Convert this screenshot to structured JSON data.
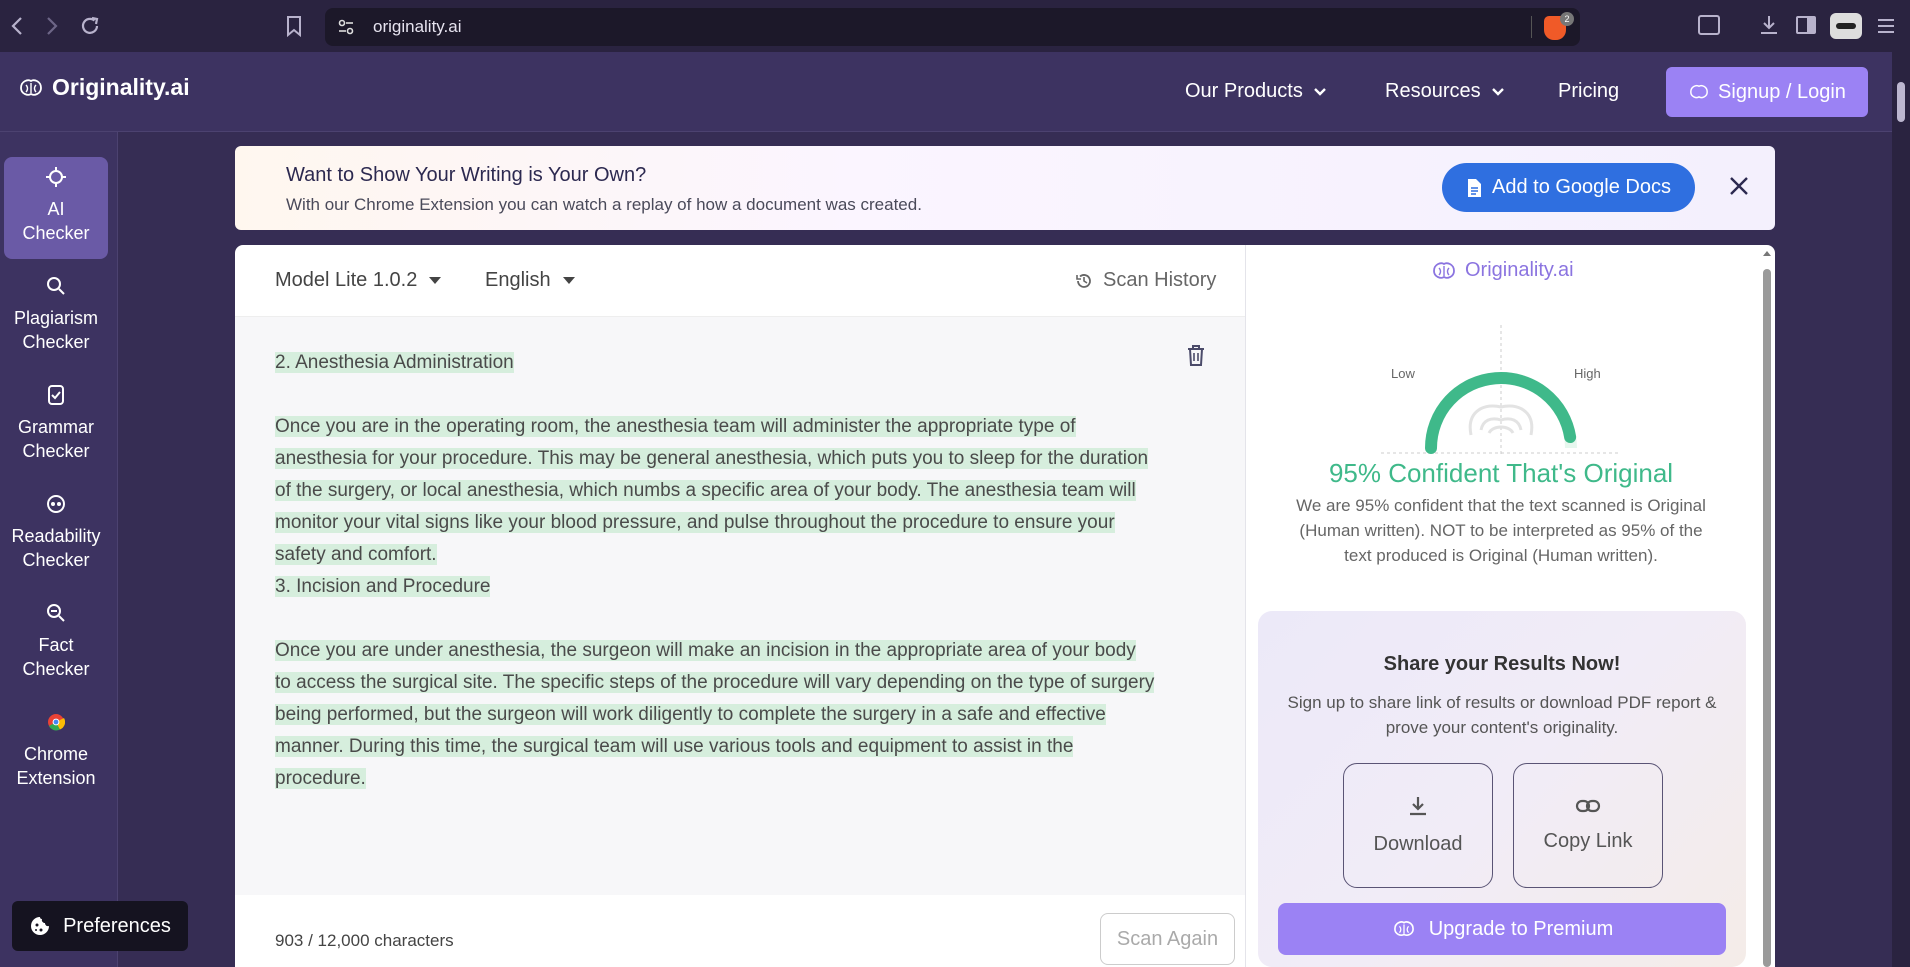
{
  "browser": {
    "url": "originality.ai",
    "brave_badge": "2"
  },
  "header": {
    "logo": "Originality.ai",
    "nav": [
      "Our Products",
      "Resources",
      "Pricing"
    ],
    "signup": "Signup / Login"
  },
  "sidebar": {
    "items": [
      {
        "line1": "AI",
        "line2": "Checker",
        "icon": "ai-chip-icon"
      },
      {
        "line1": "Plagiarism",
        "line2": "Checker",
        "icon": "magnify-icon"
      },
      {
        "line1": "Grammar",
        "line2": "Checker",
        "icon": "check-doc-icon"
      },
      {
        "line1": "Readability",
        "line2": "Checker",
        "icon": "readability-icon"
      },
      {
        "line1": "Fact",
        "line2": "Checker",
        "icon": "fact-magnify-icon"
      },
      {
        "line1": "Chrome",
        "line2": "Extension",
        "icon": "chrome-icon"
      }
    ],
    "preferences": "Preferences"
  },
  "banner": {
    "title": "Want to Show Your Writing is Your Own?",
    "subtitle": "With our Chrome Extension you can watch a replay of how a document was created.",
    "button": "Add to Google Docs",
    "close": "✕"
  },
  "editor": {
    "model": "Model Lite 1.0.2",
    "language": "English",
    "scan_history": "Scan History",
    "heading1": "2. Anesthesia Administration",
    "para1": "Once you are in the operating room, the anesthesia team will administer the appropriate type of anesthesia for your procedure. This may be general anesthesia, which puts you to sleep for the duration of the surgery, or local anesthesia, which numbs a specific area of your body. The anesthesia team will monitor your vital signs like your blood pressure, and pulse throughout the procedure to ensure your safety and comfort.",
    "heading2": "3. Incision and Procedure",
    "para2": "Once you are under anesthesia, the surgeon will make an incision in the appropriate area of your body to access the surgical site. The specific steps of the procedure will vary depending on the type of surgery being performed, but the surgeon will work diligently to complete the surgery in a safe and effective manner. During this time, the surgical team will use various tools and equipment to assist in the procedure.",
    "char_count": "903 / 12,000 characters",
    "scan_again": "Scan Again"
  },
  "results": {
    "logo": "Originality.ai",
    "gauge_low": "Low",
    "gauge_high": "High",
    "gauge_value": 0.95,
    "confidence_title": "95% Confident That's Original",
    "confidence_desc": "We are 95% confident that the text scanned is Original (Human written). NOT to be interpreted as 95% of the text produced is Original (Human written).",
    "share_title": "Share your Results Now!",
    "share_desc": "Sign up to share link of results or download PDF report & prove your content's originality.",
    "download": "Download",
    "copy_link": "Copy Link",
    "upgrade": "Upgrade to Premium"
  },
  "colors": {
    "accent": "#9b82f4",
    "original_green": "#3fb98a",
    "highlight": "#d6eedd",
    "google_blue": "#2f6fe0"
  }
}
